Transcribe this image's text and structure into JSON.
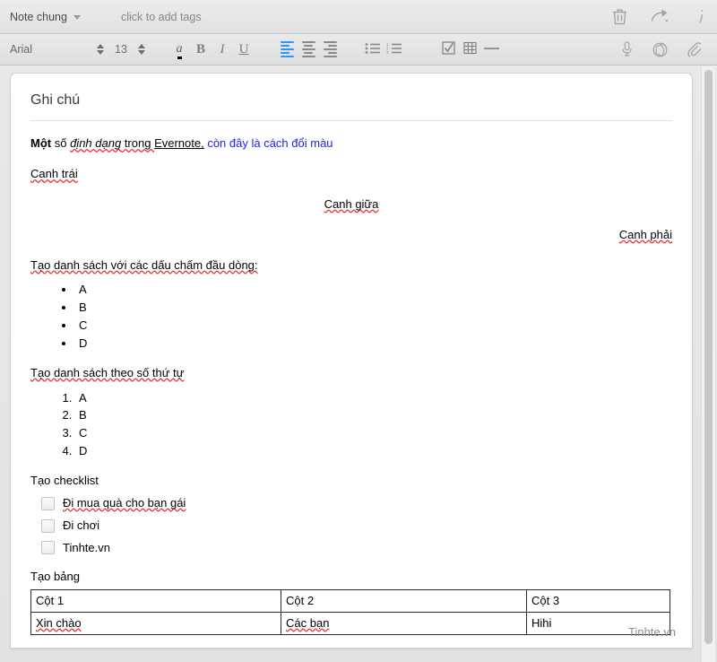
{
  "note_bar": {
    "notebook": "Note chung",
    "notebook_icon": "chevron-down-icon",
    "tags_placeholder": "click to add tags",
    "actions": [
      {
        "name": "trash-icon",
        "label": "Delete note"
      },
      {
        "name": "share-icon",
        "label": "Share note"
      },
      {
        "name": "info-icon",
        "label": "Note info"
      }
    ]
  },
  "toolbar": {
    "font_family": "Arial",
    "font_size": "13",
    "text_color_label": "a",
    "bold_label": "B",
    "italic_label": "I",
    "underline_label": "U",
    "align_left": "align-left",
    "align_center": "align-center",
    "align_right": "align-right",
    "bullet_list": "bullet-list",
    "numbered_list": "numbered-list",
    "checkbox_tool": "checkbox",
    "table_tool": "table",
    "horizontal_rule": "horizontal-rule",
    "audio_tool": "microphone",
    "camera_tool": "camera",
    "attach_tool": "paperclip",
    "accent_color": "#2f96f5"
  },
  "note": {
    "title": "Ghi chú",
    "intro": {
      "bold": "Một",
      "plain1": " số ",
      "italic": "định dạng",
      "plain2": " trong ",
      "underline": "Evernote,",
      "blue": " còn đây là cách đổi màu"
    },
    "align_left_text": "Canh trái",
    "align_center_text": "Canh giữa",
    "align_right_text": "Canh phải",
    "bullet_heading": "Tạo danh sách với các dấu chấm đầu dòng:",
    "bullet_items": [
      "A",
      "B",
      "C",
      "D"
    ],
    "ordered_heading": "Tạo danh sách theo số thứ tự",
    "ordered_items": [
      "A",
      "B",
      "C",
      "D"
    ],
    "checklist_heading": "Tạo checklist",
    "checklist_items": [
      {
        "label": "Đi mua quà cho bạn gái",
        "checked": false
      },
      {
        "label": "Đi chơi",
        "checked": false
      },
      {
        "label": "Tinhte.vn",
        "checked": false
      }
    ],
    "table_heading": "Tạo bảng",
    "table": {
      "headers": [
        "Cột 1",
        "Cột 2",
        "Cột 3"
      ],
      "rows": [
        [
          "Xin chào",
          "Các bạn",
          "Hihi"
        ]
      ]
    },
    "watermark": "Tinhte.vn"
  }
}
